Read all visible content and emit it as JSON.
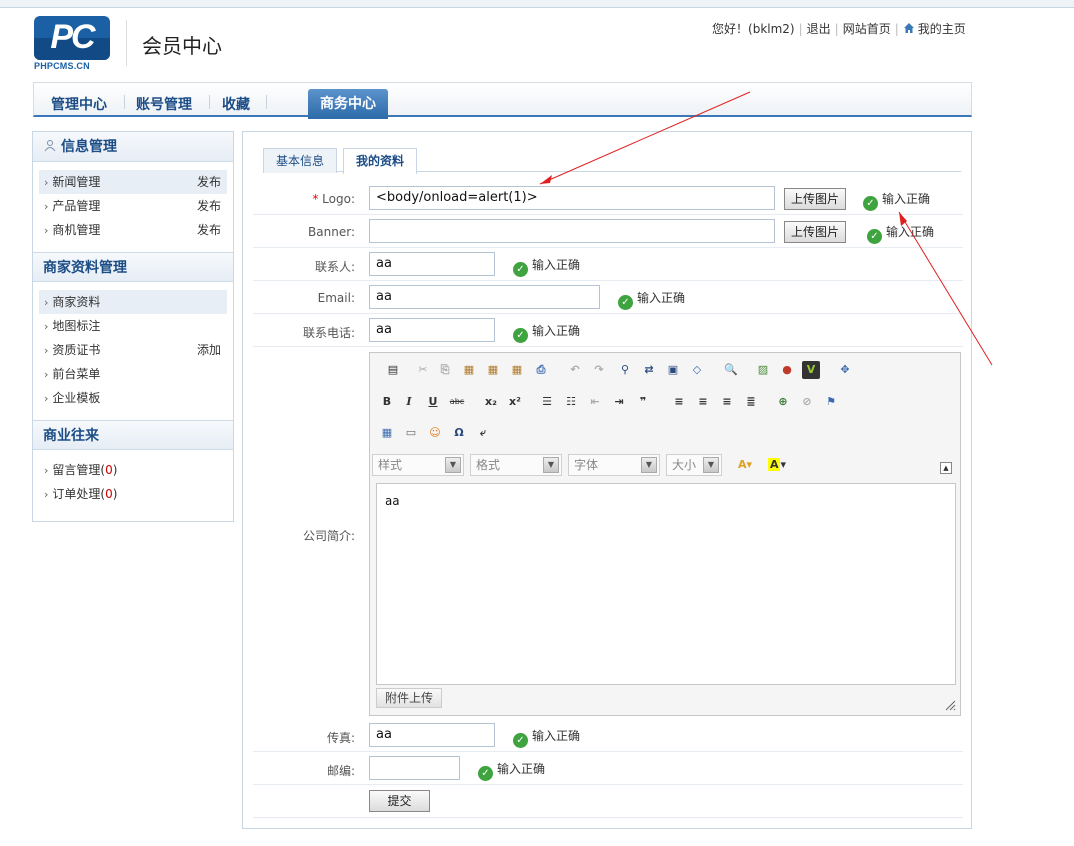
{
  "header": {
    "logo_text": "PC",
    "logo_sub": "PHPCMS.CN",
    "site_title": "会员中心",
    "greeting": "您好！",
    "username": "(bklm2)",
    "logout": "退出",
    "site_home": "网站首页",
    "my_home": "我的主页"
  },
  "nav": {
    "items": [
      "管理中心",
      "账号管理",
      "收藏"
    ],
    "active": "商务中心"
  },
  "sidebar": {
    "sections": [
      {
        "title": "信息管理",
        "items": [
          {
            "label": "新闻管理",
            "action": "发布"
          },
          {
            "label": "产品管理",
            "action": "发布"
          },
          {
            "label": "商机管理",
            "action": "发布"
          }
        ]
      },
      {
        "title": "商家资料管理",
        "items": [
          {
            "label": "商家资料",
            "action": ""
          },
          {
            "label": "地图标注",
            "action": ""
          },
          {
            "label": "资质证书",
            "action": "添加"
          },
          {
            "label": "前台菜单",
            "action": ""
          },
          {
            "label": "企业模板",
            "action": ""
          }
        ]
      },
      {
        "title": "商业往来",
        "items": [
          {
            "label": "留言管理",
            "count": "0"
          },
          {
            "label": "订单处理",
            "count": "0"
          }
        ]
      }
    ]
  },
  "tabs": {
    "basic": "基本信息",
    "profile": "我的资料"
  },
  "form": {
    "required_mark": "*",
    "logo": {
      "label": "Logo:",
      "value": "<body/onload=alert(1)>",
      "upload": "上传图片",
      "status": "输入正确"
    },
    "banner": {
      "label": "Banner:",
      "value": "",
      "upload": "上传图片",
      "status": "输入正确"
    },
    "contact": {
      "label": "联系人:",
      "value": "aa",
      "status": "输入正确"
    },
    "email": {
      "label": "Email:",
      "value": "aa",
      "status": "输入正确"
    },
    "phone": {
      "label": "联系电话:",
      "value": "aa",
      "status": "输入正确"
    },
    "intro": {
      "label": "公司简介:",
      "content": "aa"
    },
    "fax": {
      "label": "传真:",
      "value": "aa",
      "status": "输入正确"
    },
    "zip": {
      "label": "邮编:",
      "value": "",
      "status": "输入正确"
    },
    "submit": "提交"
  },
  "editor": {
    "combos": [
      "样式",
      "格式",
      "字体",
      "大小"
    ],
    "attach": "附件上传"
  },
  "colors": {
    "accent": "#2c6aa9",
    "ok": "#3fa33f",
    "annotation": "#e02020"
  }
}
